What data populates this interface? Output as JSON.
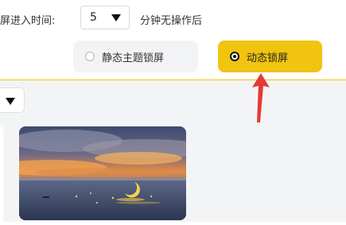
{
  "settings": {
    "lock_time_label": "屏进入时间:",
    "minutes_value": "5",
    "minutes_suffix": "分钟无操作后"
  },
  "lock_mode": {
    "options": [
      {
        "label": "静态主题锁屏",
        "selected": false
      },
      {
        "label": "动态锁屏",
        "selected": true
      }
    ],
    "accent_color": "#f1c40f"
  },
  "annotation": {
    "arrow_color": "#e53935"
  },
  "icons": {
    "select_arrow": "caret-down-icon",
    "filter_arrow": "caret-down-icon",
    "radio_off": "radio-unchecked-icon",
    "radio_on": "radio-checked-icon"
  }
}
